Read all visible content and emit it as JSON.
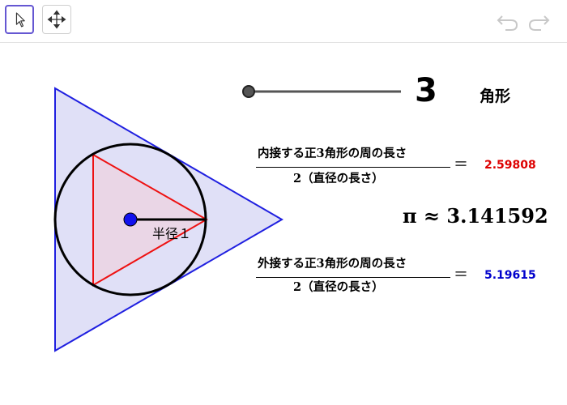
{
  "toolbar": {
    "tools": [
      {
        "name": "move-tool",
        "icon": "cursor-arrow-icon",
        "active": true
      },
      {
        "name": "move-graphics-view-tool",
        "icon": "move-arrows-icon",
        "active": false
      }
    ],
    "undo_icon": "undo-icon",
    "redo_icon": "redo-icon"
  },
  "slider": {
    "value": "3",
    "unit_label": "角形"
  },
  "figure": {
    "radius_label": "半径１",
    "colors": {
      "outer_triangle_stroke": "#1f1fe0",
      "outer_triangle_fill": "#e0e0f7",
      "inner_triangle_stroke": "#ee1111",
      "inner_triangle_fill": "#ead6e6",
      "circle": "#000000",
      "center_point": "#1111ee"
    }
  },
  "formulas": {
    "inscribed": {
      "numerator": "内接する正3角形の周の長さ",
      "denominator": "2（直径の長さ）",
      "equals": "＝",
      "value": "2.59808",
      "color": "#dd0000"
    },
    "pi": {
      "text": "π ≈ 3.141592"
    },
    "circumscribed": {
      "numerator": "外接する正3角形の周の長さ",
      "denominator": "2（直径の長さ）",
      "equals": "＝",
      "value": "5.19615",
      "color": "#0000cc"
    }
  }
}
